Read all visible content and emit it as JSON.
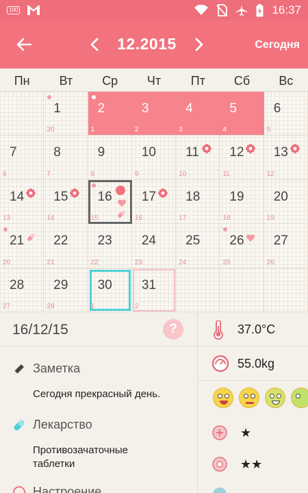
{
  "status": {
    "time": "16:37",
    "battery_badge": "100"
  },
  "appbar": {
    "month": "12.2015",
    "today_label": "Сегодня"
  },
  "weekdays": [
    "Пн",
    "Вт",
    "Ср",
    "Чт",
    "Пт",
    "Сб",
    "Вс"
  ],
  "weeks": [
    [
      {
        "day": "",
        "cycle": "",
        "empty": true
      },
      {
        "day": "1",
        "cycle": "20",
        "dot": true
      },
      {
        "day": "2",
        "cycle": "1",
        "period": true,
        "dot": true
      },
      {
        "day": "3",
        "cycle": "2",
        "period": true
      },
      {
        "day": "4",
        "cycle": "3",
        "period": true
      },
      {
        "day": "5",
        "cycle": "4",
        "period": true
      },
      {
        "day": "6",
        "cycle": "5"
      }
    ],
    [
      {
        "day": "7",
        "cycle": "6"
      },
      {
        "day": "8",
        "cycle": "7"
      },
      {
        "day": "9",
        "cycle": "8"
      },
      {
        "day": "10",
        "cycle": "9"
      },
      {
        "day": "11",
        "cycle": "10",
        "flower": true
      },
      {
        "day": "12",
        "cycle": "11",
        "flower": true
      },
      {
        "day": "13",
        "cycle": "12",
        "flower": true
      }
    ],
    [
      {
        "day": "14",
        "cycle": "13",
        "flower": true
      },
      {
        "day": "15",
        "cycle": "14",
        "flower": true
      },
      {
        "day": "16",
        "cycle": "15",
        "selected": true,
        "dot": true,
        "heart": true,
        "pill": true
      },
      {
        "day": "17",
        "cycle": "16",
        "flower": true
      },
      {
        "day": "18",
        "cycle": "17"
      },
      {
        "day": "19",
        "cycle": "18"
      },
      {
        "day": "20",
        "cycle": "19"
      }
    ],
    [
      {
        "day": "21",
        "cycle": "20",
        "dot": true,
        "pill": true
      },
      {
        "day": "22",
        "cycle": "21"
      },
      {
        "day": "23",
        "cycle": "22"
      },
      {
        "day": "24",
        "cycle": "23"
      },
      {
        "day": "25",
        "cycle": "24"
      },
      {
        "day": "26",
        "cycle": "25",
        "dot": true,
        "heart": true
      },
      {
        "day": "27",
        "cycle": "26"
      }
    ],
    [
      {
        "day": "28",
        "cycle": "27"
      },
      {
        "day": "29",
        "cycle": "28"
      },
      {
        "day": "30",
        "cycle": "1",
        "today": true
      },
      {
        "day": "31",
        "cycle": "2",
        "future": true
      },
      {
        "day": "",
        "cycle": "",
        "empty": true
      },
      {
        "day": "",
        "cycle": "",
        "empty": true
      },
      {
        "day": "",
        "cycle": "",
        "empty": true
      }
    ]
  ],
  "details": {
    "date": "16/12/15",
    "help": "?",
    "note_label": "Заметка",
    "note_text": "Сегодня прекрасный день.",
    "medicine_label": "Лекарство",
    "medicine_text_line1": "Противозачаточные",
    "medicine_text_line2": "таблетки",
    "mood_label": "Настроение"
  },
  "metrics": {
    "temperature": "37.0°C",
    "weight": "55.0kg",
    "icon_names": [
      "thermometer-icon",
      "scale-icon",
      "mood-emoji-icon",
      "sex-icon",
      "ovulation-test-icon"
    ],
    "ratings": {
      "row1": "★",
      "row2": "★★"
    }
  },
  "colors": {
    "accent": "#f2727d",
    "period": "#f7838c",
    "today_outline": "#4dd0d6",
    "cycle_text": "#e88d96"
  }
}
